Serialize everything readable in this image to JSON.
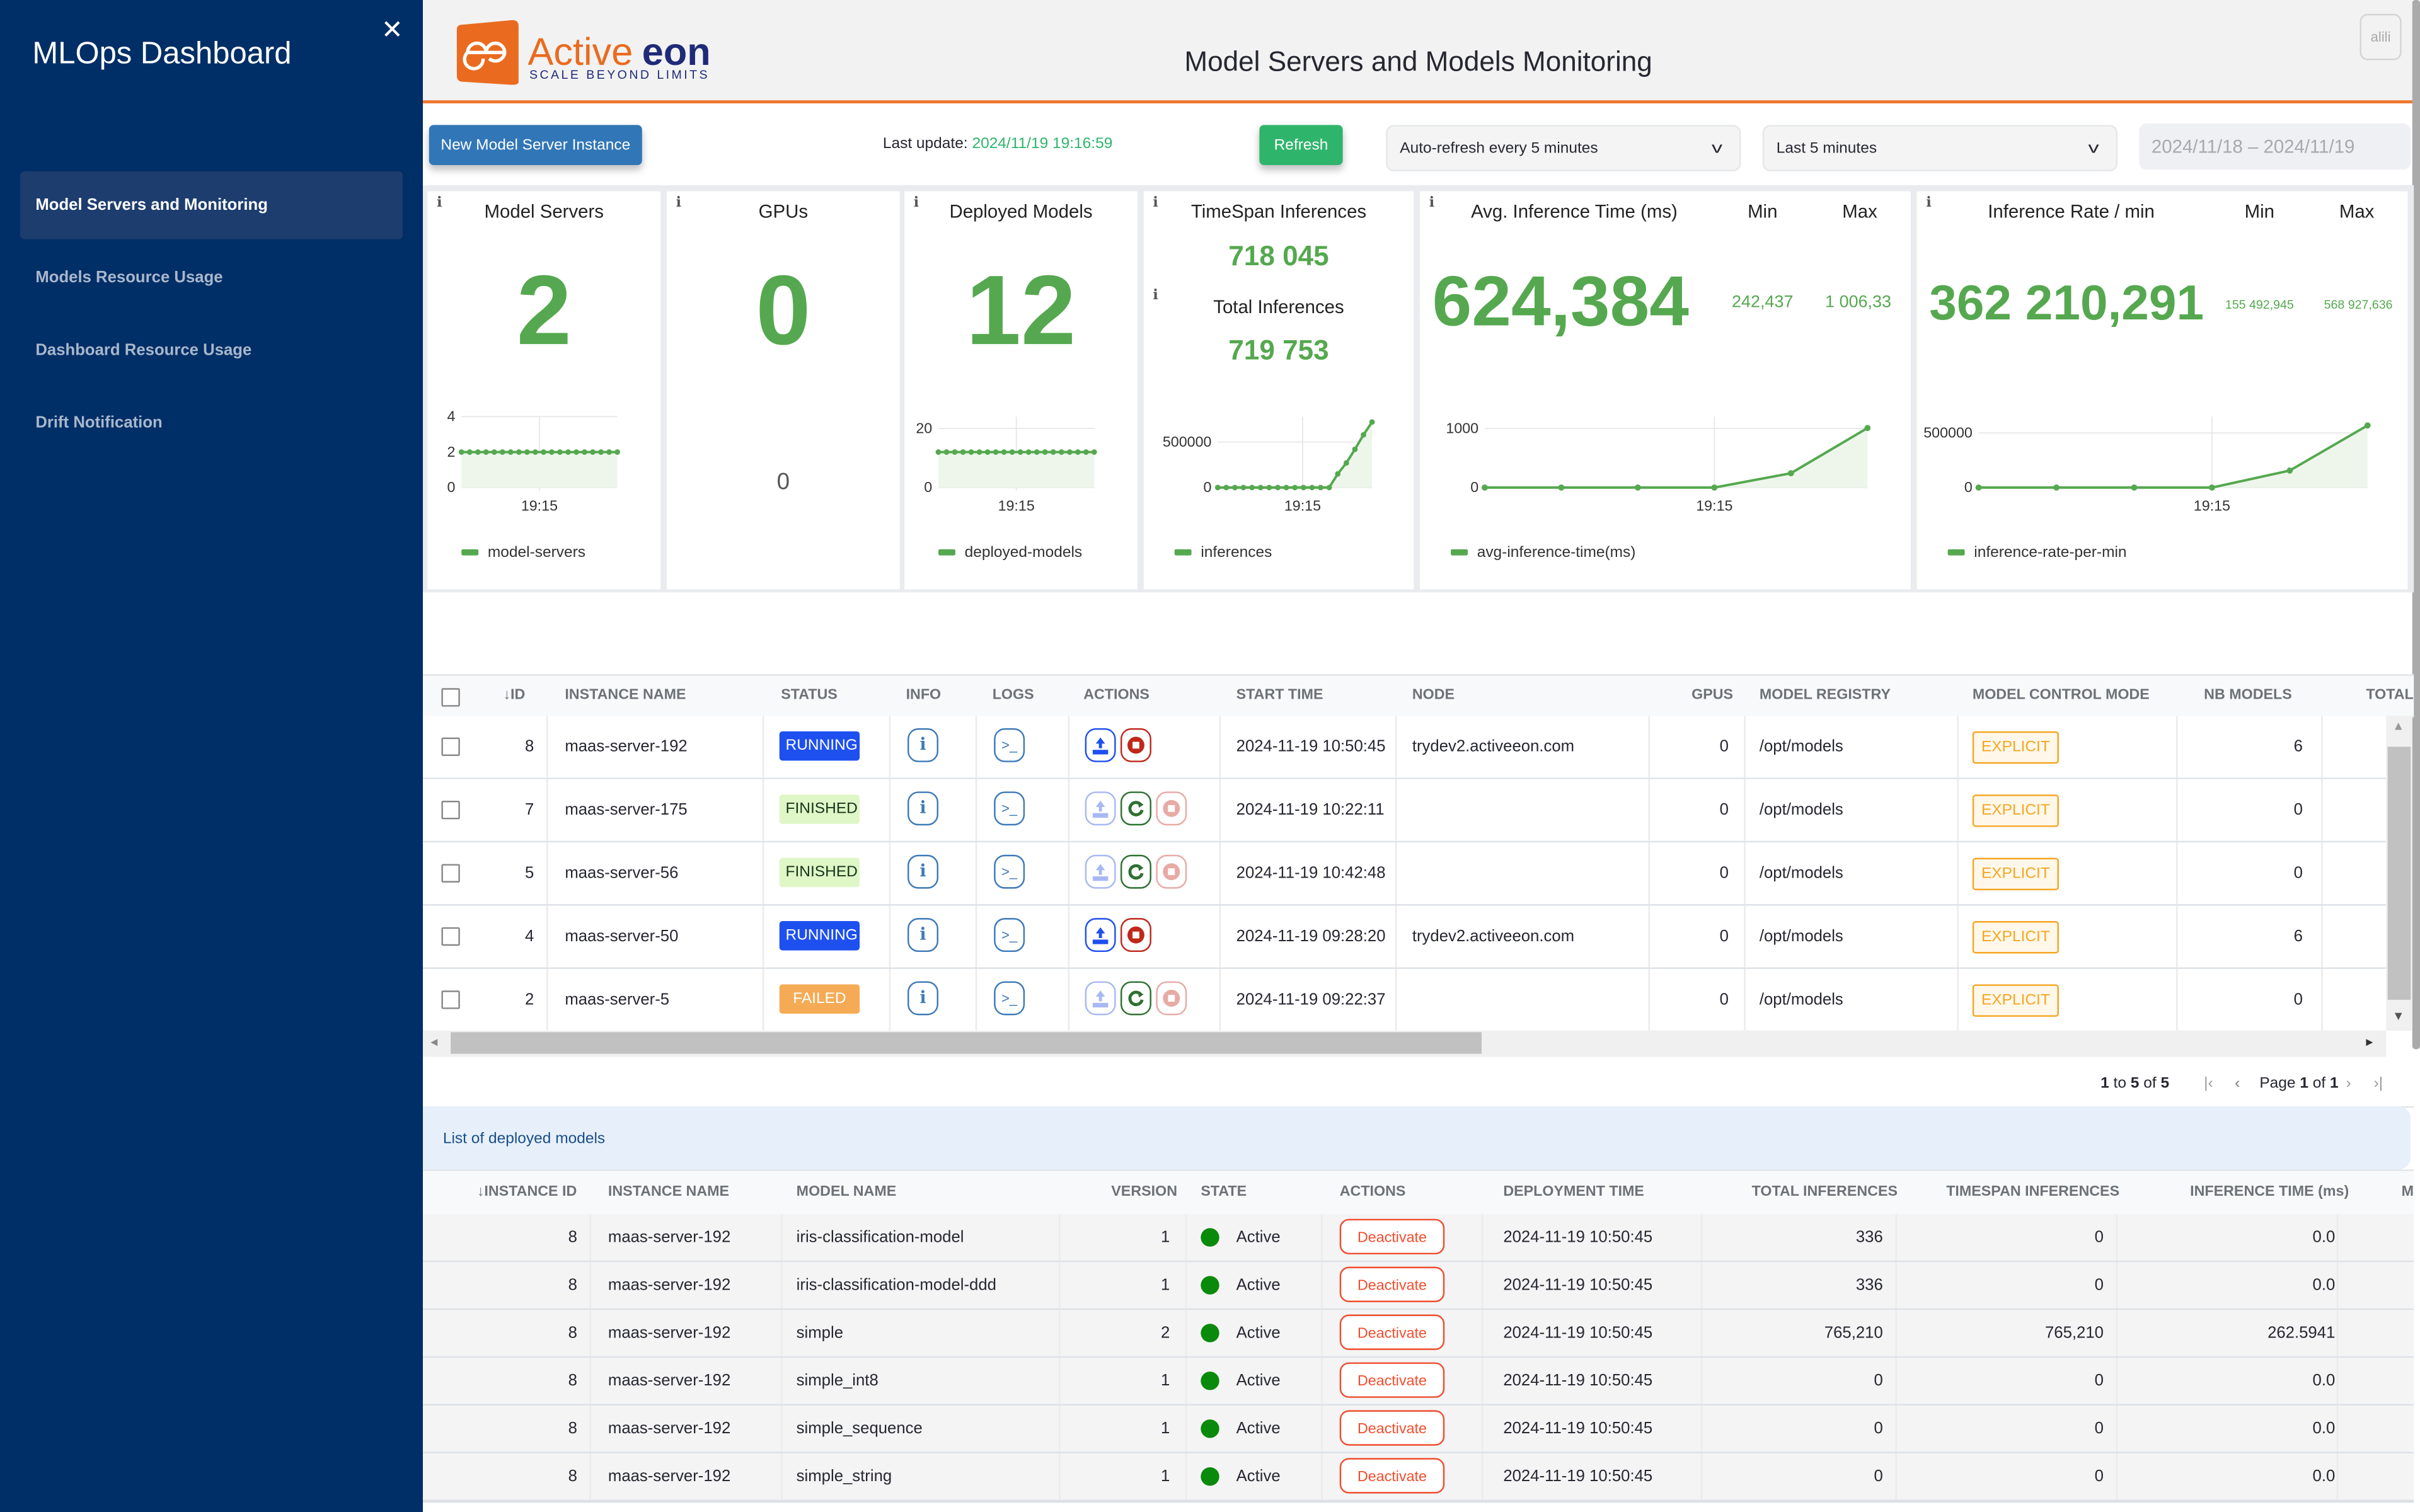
{
  "sidebar": {
    "title": "MLOps Dashboard",
    "close_icon": "close-icon",
    "items": [
      {
        "label": "Model Servers and Monitoring",
        "active": true
      },
      {
        "label": "Models Resource Usage",
        "active": false
      },
      {
        "label": "Dashboard Resource Usage",
        "active": false
      },
      {
        "label": "Drift Notification",
        "active": false
      }
    ]
  },
  "header": {
    "logo_brand_left": "Active",
    "logo_brand_right": "eon",
    "logo_tagline": "SCALE BEYOND LIMITS",
    "title": "Model Servers and Models Monitoring",
    "user_button": "alili"
  },
  "controls": {
    "new_instance_label": "New Model Server Instance",
    "last_update_label": "Last update:",
    "last_update_value": "2024/11/19 19:16:59",
    "refresh_label": "Refresh",
    "auto_refresh_selected": "Auto-refresh every 5 minutes",
    "timespan_selected": "Last 5 minutes",
    "date_range": "2024/11/18 – 2024/11/19"
  },
  "cards": {
    "info_icon": "i",
    "model_servers": {
      "title": "Model Servers",
      "value": "2",
      "legend": "model-servers",
      "xtick": "19:15",
      "yticks": [
        "4",
        "2",
        "0"
      ]
    },
    "gpus": {
      "title": "GPUs",
      "value": "0",
      "sub_value": "0"
    },
    "deployed_models": {
      "title": "Deployed Models",
      "value": "12",
      "legend": "deployed-models",
      "xtick": "19:15",
      "yticks": [
        "20",
        "0"
      ]
    },
    "timespan_inferences": {
      "title": "TimeSpan Inferences",
      "value": "718 045",
      "total_title": "Total Inferences",
      "total_value": "719 753",
      "legend": "inferences",
      "xtick": "19:15",
      "yticks": [
        "500000",
        "0"
      ]
    },
    "avg_inference_time": {
      "title": "Avg. Inference Time (ms)",
      "value": "624,384",
      "min_label": "Min",
      "max_label": "Max",
      "min_value": "242,437",
      "max_value": "1 006,33",
      "legend": "avg-inference-time(ms)",
      "xtick": "19:15",
      "yticks": [
        "1000",
        "0"
      ]
    },
    "inference_rate": {
      "title": "Inference Rate / min",
      "value": "362 210,291",
      "min_label": "Min",
      "max_label": "Max",
      "min_value": "155 492,945",
      "max_value": "568 927,636",
      "legend": "inference-rate-per-min",
      "xtick": "19:15",
      "yticks": [
        "500000",
        "0"
      ]
    }
  },
  "chart_data": [
    {
      "type": "area",
      "title": "Model Servers",
      "series": [
        {
          "name": "model-servers",
          "values": [
            2,
            2,
            2,
            2,
            2,
            2,
            2,
            2,
            2,
            2,
            2,
            2,
            2,
            2,
            2,
            2,
            2,
            2,
            2,
            2
          ]
        }
      ],
      "xlabel": "",
      "xticks": [
        "19:15"
      ],
      "ylim": [
        0,
        4
      ],
      "yticks": [
        0,
        2,
        4
      ],
      "legend": "bottom-left",
      "grid": true
    },
    {
      "type": "area",
      "title": "Deployed Models",
      "series": [
        {
          "name": "deployed-models",
          "values": [
            12,
            12,
            12,
            12,
            12,
            12,
            12,
            12,
            12,
            12,
            12,
            12,
            12,
            12,
            12,
            12,
            12,
            12,
            12,
            12
          ]
        }
      ],
      "xticks": [
        "19:15"
      ],
      "ylim": [
        0,
        24
      ],
      "yticks": [
        0,
        20
      ],
      "legend": "bottom-left",
      "grid": true
    },
    {
      "type": "area",
      "title": "TimeSpan Inferences",
      "series": [
        {
          "name": "inferences",
          "values": [
            0,
            0,
            0,
            0,
            0,
            0,
            0,
            0,
            0,
            0,
            0,
            0,
            0,
            0,
            150000,
            270000,
            420000,
            580000,
            720000
          ]
        }
      ],
      "xticks": [
        "19:15"
      ],
      "ylim": [
        0,
        780000
      ],
      "yticks": [
        0,
        500000
      ],
      "legend": "bottom-left",
      "grid": true
    },
    {
      "type": "area",
      "title": "Avg. Inference Time (ms)",
      "series": [
        {
          "name": "avg-inference-time(ms)",
          "values": [
            0,
            0,
            0,
            0,
            242.437,
            1006.33
          ]
        }
      ],
      "xticks": [
        "19:15"
      ],
      "ylim": [
        0,
        1200
      ],
      "yticks": [
        0,
        1000
      ],
      "legend": "bottom-left",
      "grid": true
    },
    {
      "type": "area",
      "title": "Inference Rate / min",
      "series": [
        {
          "name": "inference-rate-per-min",
          "values": [
            0,
            0,
            0,
            0,
            155492.945,
            568927.636
          ]
        }
      ],
      "xticks": [
        "19:15"
      ],
      "ylim": [
        0,
        650000
      ],
      "yticks": [
        0,
        500000
      ],
      "legend": "bottom-left",
      "grid": true
    }
  ],
  "servers_table": {
    "headers": {
      "id": "ID",
      "instance_name": "INSTANCE NAME",
      "status": "STATUS",
      "info": "INFO",
      "logs": "LOGS",
      "actions": "ACTIONS",
      "start_time": "START TIME",
      "node": "NODE",
      "gpus": "GPUS",
      "model_registry": "MODEL REGISTRY",
      "model_control_mode": "MODEL CONTROL MODE",
      "nb_models": "NB MODELS",
      "total": "TOTAL"
    },
    "rows": [
      {
        "id": "8",
        "name": "maas-server-192",
        "status": "RUNNING",
        "start": "2024-11-19 10:50:45",
        "node": "trydev2.activeeon.com",
        "gpus": "0",
        "registry": "/opt/models",
        "mode": "EXPLICIT",
        "nb_models": "6"
      },
      {
        "id": "7",
        "name": "maas-server-175",
        "status": "FINISHED",
        "start": "2024-11-19 10:22:11",
        "node": "",
        "gpus": "0",
        "registry": "/opt/models",
        "mode": "EXPLICIT",
        "nb_models": "0"
      },
      {
        "id": "5",
        "name": "maas-server-56",
        "status": "FINISHED",
        "start": "2024-11-19 10:42:48",
        "node": "",
        "gpus": "0",
        "registry": "/opt/models",
        "mode": "EXPLICIT",
        "nb_models": "0"
      },
      {
        "id": "4",
        "name": "maas-server-50",
        "status": "RUNNING",
        "start": "2024-11-19 09:28:20",
        "node": "trydev2.activeeon.com",
        "gpus": "0",
        "registry": "/opt/models",
        "mode": "EXPLICIT",
        "nb_models": "6"
      },
      {
        "id": "2",
        "name": "maas-server-5",
        "status": "FAILED",
        "start": "2024-11-19 09:22:37",
        "node": "",
        "gpus": "0",
        "registry": "/opt/models",
        "mode": "EXPLICIT",
        "nb_models": "0"
      }
    ],
    "pager": {
      "range_start": "1",
      "range_end": "5",
      "total": "5",
      "page": "1",
      "pages": "1",
      "to": "to",
      "of": "of",
      "page_label": "Page"
    }
  },
  "deployed_models": {
    "section_title": "List of deployed models",
    "headers": {
      "instance_id": "INSTANCE ID",
      "instance_name": "INSTANCE NAME",
      "model_name": "MODEL NAME",
      "version": "VERSION",
      "state": "STATE",
      "actions": "ACTIONS",
      "deployment_time": "DEPLOYMENT TIME",
      "total_inferences": "TOTAL INFERENCES",
      "timespan_inferences": "TIMESPAN INFERENCES",
      "inference_time": "INFERENCE TIME (ms)",
      "next": "M"
    },
    "deactivate_label": "Deactivate",
    "rows": [
      {
        "instance_id": "8",
        "instance_name": "maas-server-192",
        "model_name": "iris-classification-model",
        "version": "1",
        "state": "Active",
        "deployment_time": "2024-11-19 10:50:45",
        "total": "336",
        "timespan": "0",
        "inf_time": "0.0"
      },
      {
        "instance_id": "8",
        "instance_name": "maas-server-192",
        "model_name": "iris-classification-model-ddd",
        "version": "1",
        "state": "Active",
        "deployment_time": "2024-11-19 10:50:45",
        "total": "336",
        "timespan": "0",
        "inf_time": "0.0"
      },
      {
        "instance_id": "8",
        "instance_name": "maas-server-192",
        "model_name": "simple",
        "version": "2",
        "state": "Active",
        "deployment_time": "2024-11-19 10:50:45",
        "total": "765,210",
        "timespan": "765,210",
        "inf_time": "262.5941"
      },
      {
        "instance_id": "8",
        "instance_name": "maas-server-192",
        "model_name": "simple_int8",
        "version": "1",
        "state": "Active",
        "deployment_time": "2024-11-19 10:50:45",
        "total": "0",
        "timespan": "0",
        "inf_time": "0.0"
      },
      {
        "instance_id": "8",
        "instance_name": "maas-server-192",
        "model_name": "simple_sequence",
        "version": "1",
        "state": "Active",
        "deployment_time": "2024-11-19 10:50:45",
        "total": "0",
        "timespan": "0",
        "inf_time": "0.0"
      },
      {
        "instance_id": "8",
        "instance_name": "maas-server-192",
        "model_name": "simple_string",
        "version": "1",
        "state": "Active",
        "deployment_time": "2024-11-19 10:50:45",
        "total": "0",
        "timespan": "0",
        "inf_time": "0.0"
      }
    ]
  },
  "colors": {
    "sidebar_bg": "#002e66",
    "accent_orange": "#f07830",
    "metric_green": "#55a84f",
    "running_blue": "#1e50f0",
    "finished_green_bg": "#dff7c6",
    "failed_orange": "#f5ab55",
    "explicit_orange": "#f5a623",
    "deactivate_red": "#f04e2e",
    "active_dot": "#0a8a0a"
  }
}
